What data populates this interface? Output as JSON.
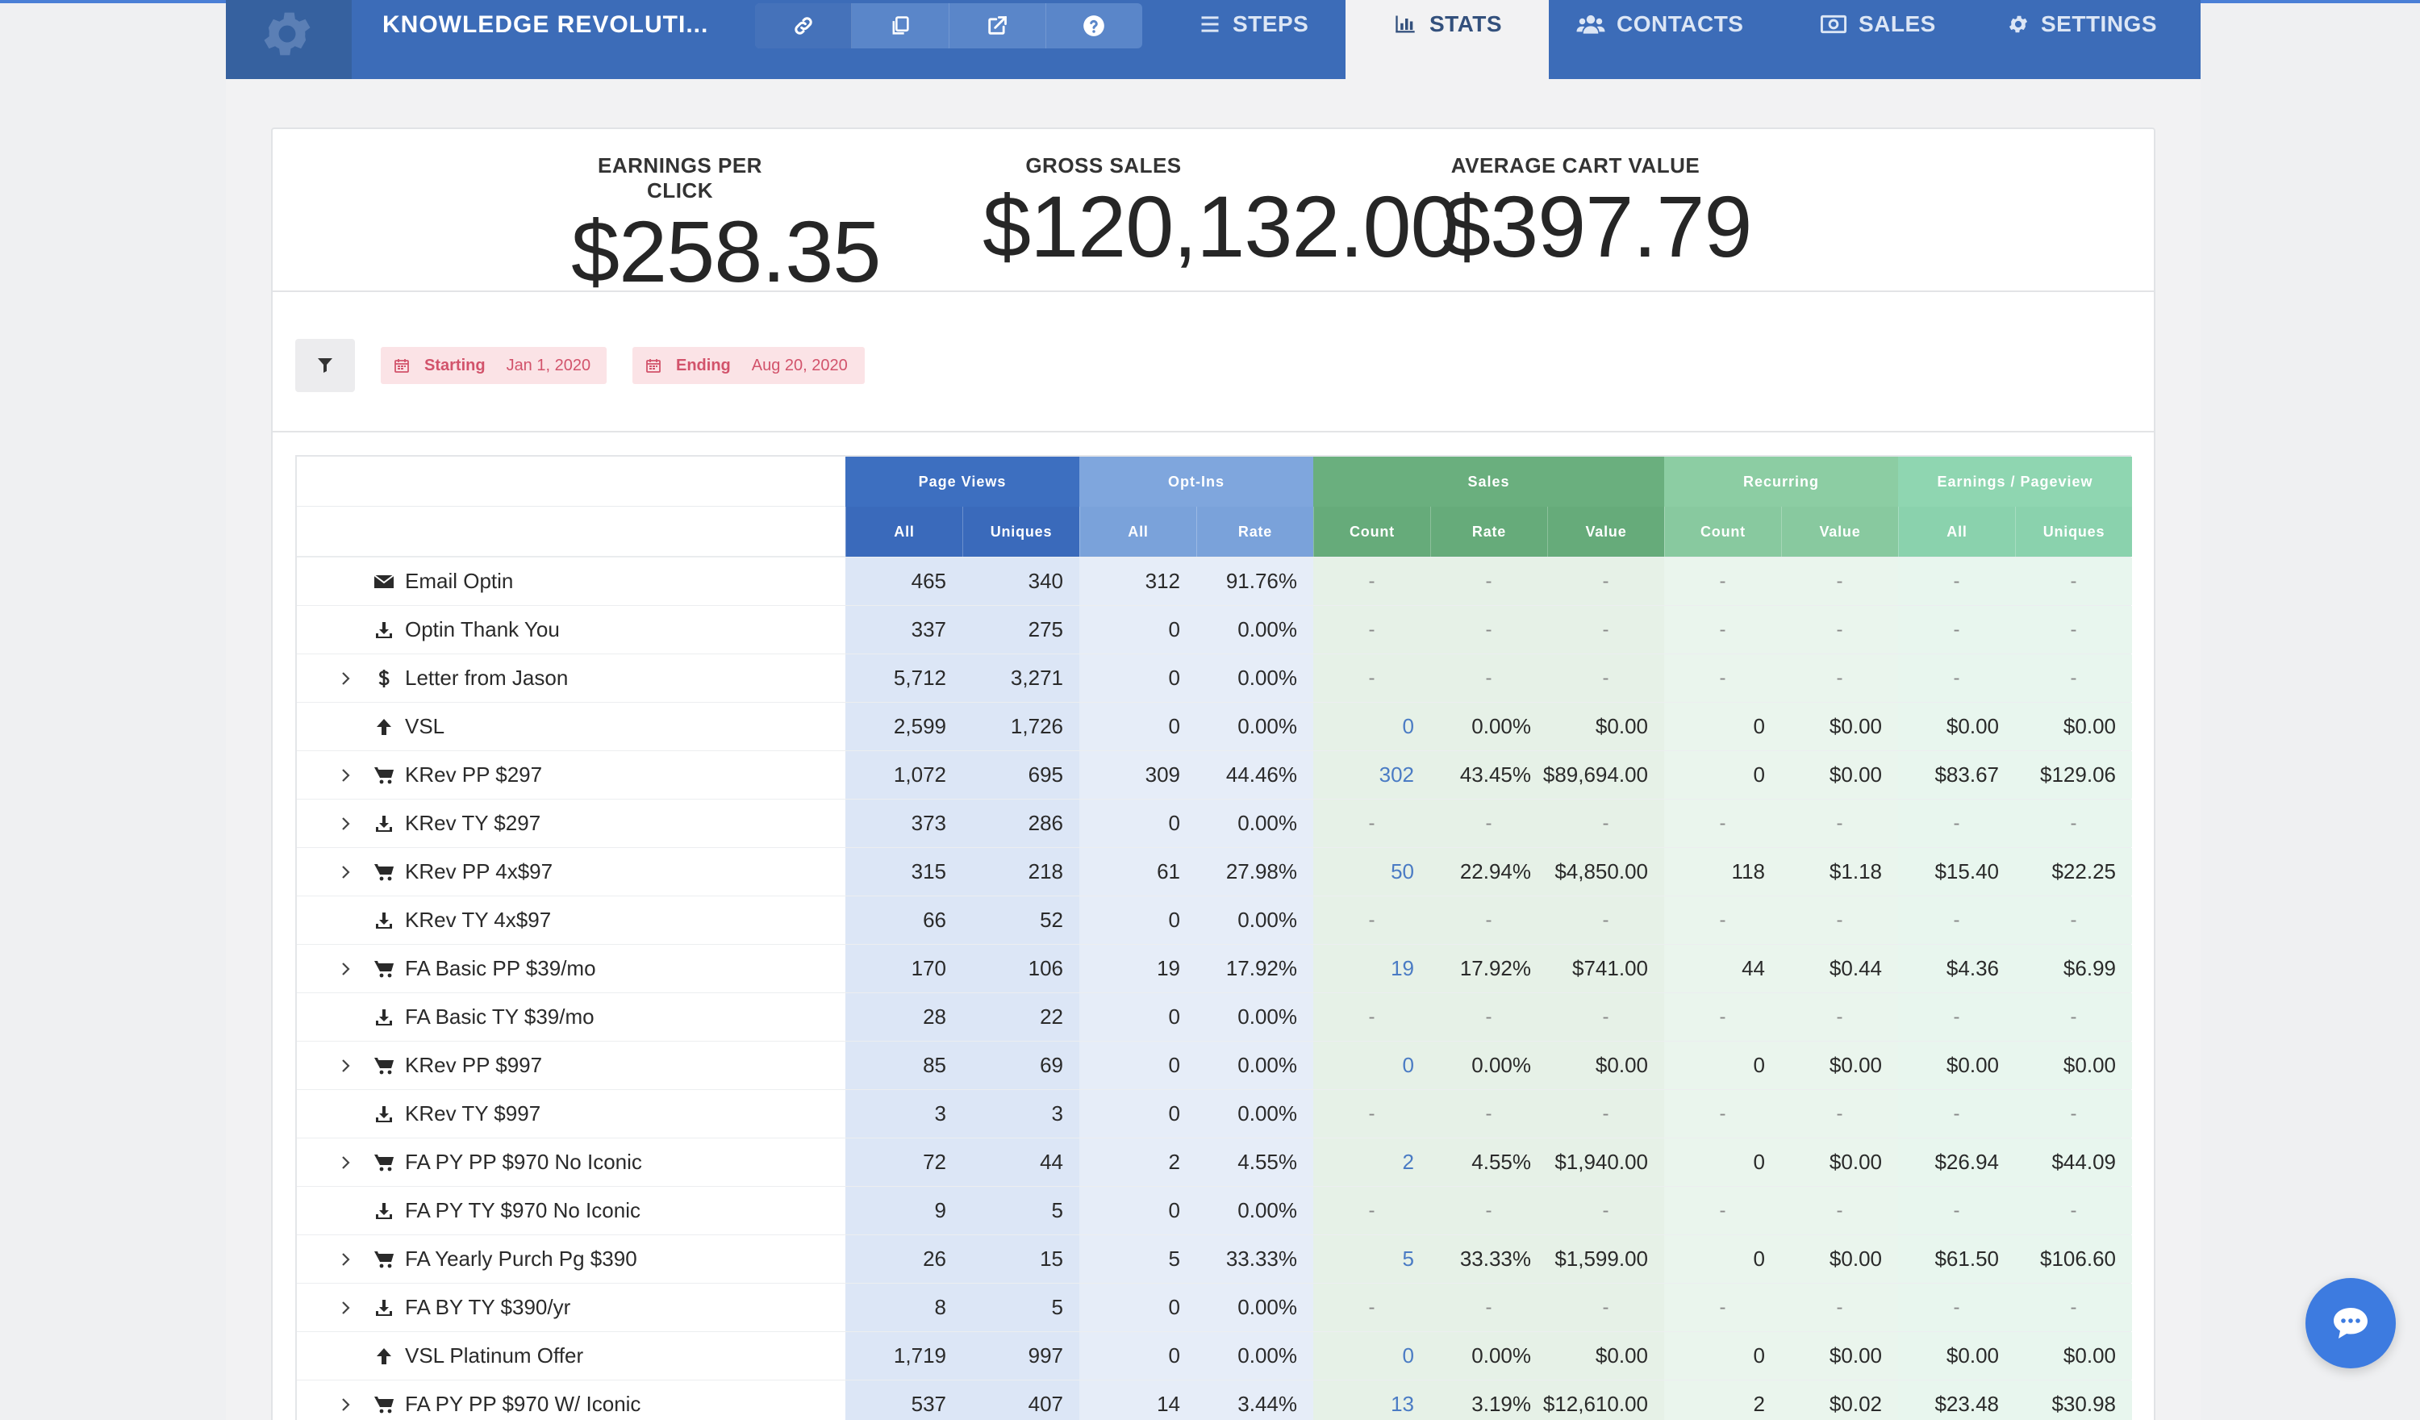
{
  "header": {
    "funnel_title": "KNOWLEDGE REVOLUTI...",
    "tabs": [
      {
        "label": "STEPS",
        "icon": "list-icon"
      },
      {
        "label": "STATS",
        "icon": "bar-chart-icon",
        "active": true
      },
      {
        "label": "CONTACTS",
        "icon": "users-icon"
      },
      {
        "label": "SALES",
        "icon": "money-icon"
      },
      {
        "label": "SETTINGS",
        "icon": "gear-icon"
      }
    ],
    "tool_icons": [
      "link-icon",
      "copy-icon",
      "external-link-icon",
      "help-icon"
    ]
  },
  "metrics": [
    {
      "label": "EARNINGS PER CLICK",
      "value": "$258.35"
    },
    {
      "label": "GROSS SALES",
      "value": "$120,132.00"
    },
    {
      "label": "AVERAGE CART VALUE",
      "value": "$397.79"
    }
  ],
  "filters": {
    "start": {
      "label": "Starting",
      "value": "Jan 1, 2020"
    },
    "end": {
      "label": "Ending",
      "value": "Aug 20, 2020"
    }
  },
  "table": {
    "groups": [
      {
        "label": "Page Views",
        "subs": [
          "All",
          "Uniques"
        ]
      },
      {
        "label": "Opt-Ins",
        "subs": [
          "All",
          "Rate"
        ]
      },
      {
        "label": "Sales",
        "subs": [
          "Count",
          "Rate",
          "Value"
        ]
      },
      {
        "label": "Recurring",
        "subs": [
          "Count",
          "Value"
        ]
      },
      {
        "label": "Earnings / Pageview",
        "subs": [
          "All",
          "Uniques"
        ]
      }
    ],
    "rows": [
      {
        "name": "Email Optin",
        "icon": "envelope-icon",
        "expandable": false,
        "values": [
          "465",
          "340",
          "312",
          "91.76%",
          "-",
          "-",
          "-",
          "-",
          "-",
          "-",
          "-"
        ]
      },
      {
        "name": "Optin Thank You",
        "icon": "download-icon",
        "expandable": false,
        "values": [
          "337",
          "275",
          "0",
          "0.00%",
          "-",
          "-",
          "-",
          "-",
          "-",
          "-",
          "-"
        ]
      },
      {
        "name": "Letter from Jason",
        "icon": "dollar-icon",
        "expandable": true,
        "values": [
          "5,712",
          "3,271",
          "0",
          "0.00%",
          "-",
          "-",
          "-",
          "-",
          "-",
          "-",
          "-"
        ]
      },
      {
        "name": "VSL",
        "icon": "arrow-up-icon",
        "expandable": false,
        "values": [
          "2,599",
          "1,726",
          "0",
          "0.00%",
          "0",
          "0.00%",
          "$0.00",
          "0",
          "$0.00",
          "$0.00",
          "$0.00"
        ]
      },
      {
        "name": "KRev PP $297",
        "icon": "cart-icon",
        "expandable": true,
        "values": [
          "1,072",
          "695",
          "309",
          "44.46%",
          "302",
          "43.45%",
          "$89,694.00",
          "0",
          "$0.00",
          "$83.67",
          "$129.06"
        ]
      },
      {
        "name": "KRev TY $297",
        "icon": "download-icon",
        "expandable": true,
        "values": [
          "373",
          "286",
          "0",
          "0.00%",
          "-",
          "-",
          "-",
          "-",
          "-",
          "-",
          "-"
        ]
      },
      {
        "name": "KRev PP 4x$97",
        "icon": "cart-icon",
        "expandable": true,
        "values": [
          "315",
          "218",
          "61",
          "27.98%",
          "50",
          "22.94%",
          "$4,850.00",
          "118",
          "$1.18",
          "$15.40",
          "$22.25"
        ]
      },
      {
        "name": "KRev TY 4x$97",
        "icon": "download-icon",
        "expandable": false,
        "values": [
          "66",
          "52",
          "0",
          "0.00%",
          "-",
          "-",
          "-",
          "-",
          "-",
          "-",
          "-"
        ]
      },
      {
        "name": "FA Basic PP $39/mo",
        "icon": "cart-icon",
        "expandable": true,
        "values": [
          "170",
          "106",
          "19",
          "17.92%",
          "19",
          "17.92%",
          "$741.00",
          "44",
          "$0.44",
          "$4.36",
          "$6.99"
        ]
      },
      {
        "name": "FA Basic TY $39/mo",
        "icon": "download-icon",
        "expandable": false,
        "values": [
          "28",
          "22",
          "0",
          "0.00%",
          "-",
          "-",
          "-",
          "-",
          "-",
          "-",
          "-"
        ]
      },
      {
        "name": "KRev PP $997",
        "icon": "cart-icon",
        "expandable": true,
        "values": [
          "85",
          "69",
          "0",
          "0.00%",
          "0",
          "0.00%",
          "$0.00",
          "0",
          "$0.00",
          "$0.00",
          "$0.00"
        ]
      },
      {
        "name": "KRev TY $997",
        "icon": "download-icon",
        "expandable": false,
        "values": [
          "3",
          "3",
          "0",
          "0.00%",
          "-",
          "-",
          "-",
          "-",
          "-",
          "-",
          "-"
        ]
      },
      {
        "name": "FA PY PP $970 No Iconic",
        "icon": "cart-icon",
        "expandable": true,
        "values": [
          "72",
          "44",
          "2",
          "4.55%",
          "2",
          "4.55%",
          "$1,940.00",
          "0",
          "$0.00",
          "$26.94",
          "$44.09"
        ]
      },
      {
        "name": "FA PY TY $970 No Iconic",
        "icon": "download-icon",
        "expandable": false,
        "values": [
          "9",
          "5",
          "0",
          "0.00%",
          "-",
          "-",
          "-",
          "-",
          "-",
          "-",
          "-"
        ]
      },
      {
        "name": "FA Yearly Purch Pg $390",
        "icon": "cart-icon",
        "expandable": true,
        "values": [
          "26",
          "15",
          "5",
          "33.33%",
          "5",
          "33.33%",
          "$1,599.00",
          "0",
          "$0.00",
          "$61.50",
          "$106.60"
        ]
      },
      {
        "name": "FA BY TY $390/yr",
        "icon": "download-icon",
        "expandable": true,
        "values": [
          "8",
          "5",
          "0",
          "0.00%",
          "-",
          "-",
          "-",
          "-",
          "-",
          "-",
          "-"
        ]
      },
      {
        "name": "VSL Platinum Offer",
        "icon": "arrow-up-icon",
        "expandable": false,
        "values": [
          "1,719",
          "997",
          "0",
          "0.00%",
          "0",
          "0.00%",
          "$0.00",
          "0",
          "$0.00",
          "$0.00",
          "$0.00"
        ]
      },
      {
        "name": "FA PY PP $970 W/ Iconic",
        "icon": "cart-icon",
        "expandable": true,
        "values": [
          "537",
          "407",
          "14",
          "3.44%",
          "13",
          "3.19%",
          "$12,610.00",
          "2",
          "$0.02",
          "$23.48",
          "$30.98"
        ]
      }
    ]
  },
  "colors": {
    "header_bg": "#3c6cb8",
    "page_views": "#3d6fc0",
    "opt_ins": "#7fa6dd",
    "sales": "#6aaf7e",
    "recurring": "#8ccda3",
    "earnings": "#8fd6b1",
    "date_chip_text": "#d2536b"
  },
  "chat": {
    "icon": "chat-bubble-icon"
  }
}
